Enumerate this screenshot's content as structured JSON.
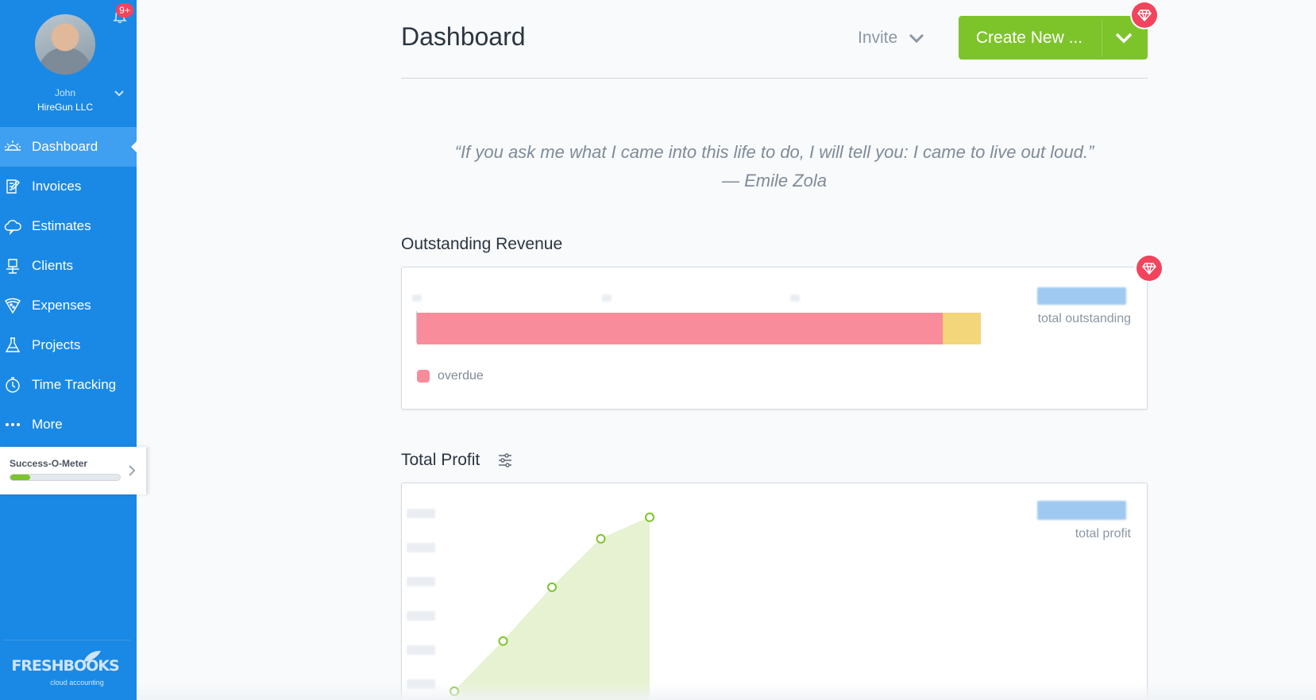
{
  "sidebar": {
    "notifications_badge": "9+",
    "user": {
      "name": "John",
      "company": "HireGun LLC"
    },
    "nav": [
      {
        "label": "Dashboard",
        "icon": "sun-icon",
        "active": true
      },
      {
        "label": "Invoices",
        "icon": "invoice-icon",
        "active": false
      },
      {
        "label": "Estimates",
        "icon": "cloud-icon",
        "active": false
      },
      {
        "label": "Clients",
        "icon": "client-icon",
        "active": false
      },
      {
        "label": "Expenses",
        "icon": "pizza-icon",
        "active": false
      },
      {
        "label": "Projects",
        "icon": "flask-icon",
        "active": false
      },
      {
        "label": "Time Tracking",
        "icon": "stopwatch-icon",
        "active": false
      },
      {
        "label": "More",
        "icon": "more-dots-icon",
        "active": false
      }
    ],
    "success_meter": {
      "label": "Success-O-Meter",
      "progress": 0.18
    },
    "logo": {
      "brand": "FRESHBOOKS",
      "tagline": "cloud accounting"
    }
  },
  "header": {
    "title": "Dashboard",
    "invite_label": "Invite",
    "create_label": "Create New ..."
  },
  "quote": {
    "text": "“If you ask me what I came into this life to do, I will tell you: I came to live out loud.”",
    "author": "— Emile Zola"
  },
  "outstanding_revenue": {
    "title": "Outstanding Revenue",
    "total_label": "total outstanding",
    "legend_label": "overdue"
  },
  "total_profit": {
    "title": "Total Profit",
    "total_label": "total profit"
  },
  "colors": {
    "sidebar": "#1a89e5",
    "accent_green": "#7dc42b",
    "overdue": "#f98c9b",
    "outstanding_other": "#f2d679",
    "gem": "#f2445c"
  },
  "chart_data": [
    {
      "type": "bar",
      "orientation": "horizontal-stacked",
      "series": [
        {
          "name": "overdue",
          "values": [
            0.933
          ]
        },
        {
          "values": [
            0.067
          ]
        }
      ]
    },
    {
      "type": "area",
      "values": [
        0,
        0.28,
        0.58,
        0.85,
        0.97
      ],
      "partial_points": 5
    }
  ]
}
